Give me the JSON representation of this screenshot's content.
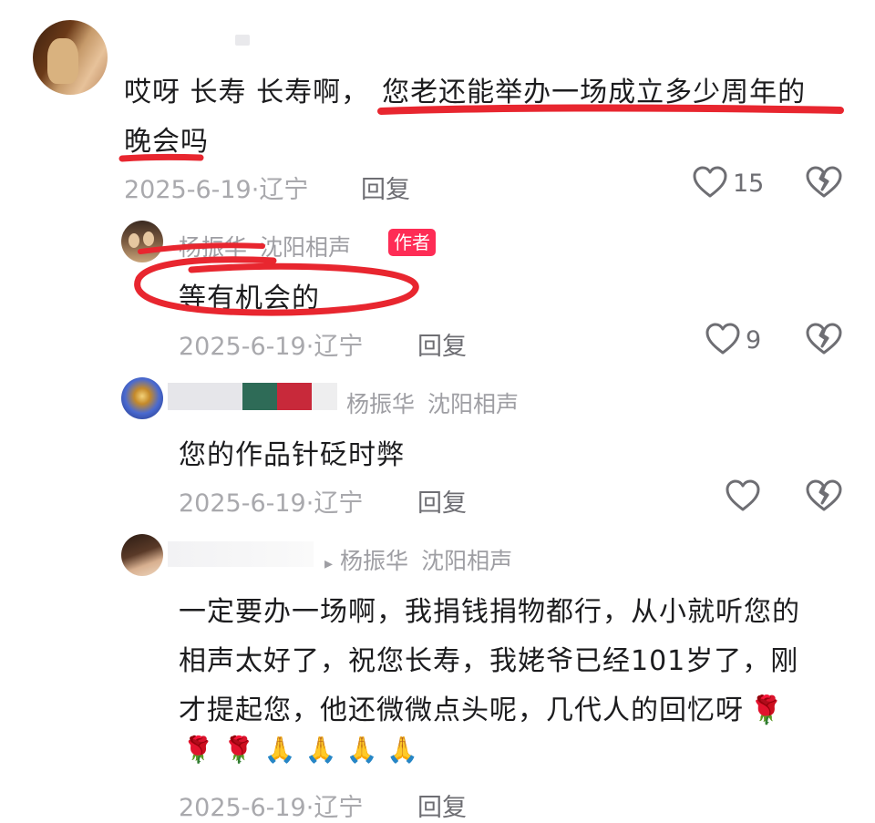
{
  "comments": [
    {
      "username": "",
      "text_line1_plain": "哎呀 长寿 长寿啊，",
      "text_line1_marked": "您老还能举办一场成立多少周年的",
      "text_line2": "晚会吗",
      "date": "2025-6-19",
      "sep": "·",
      "location": "辽宁",
      "reply_label": "回复",
      "like_count": "15"
    },
    {
      "username": "杨振华",
      "reply_to_suffix": "沈阳相声",
      "badge": "作者",
      "text": "等有机会的",
      "date": "2025-6-19",
      "sep": "·",
      "location": "辽宁",
      "reply_label": "回复",
      "like_count": "9"
    },
    {
      "reply_to": "杨振华",
      "reply_to_suffix": "沈阳相声",
      "text": "您的作品针砭时弊",
      "date": "2025-6-19",
      "sep": "·",
      "location": "辽宁",
      "reply_label": "回复",
      "like_count": ""
    },
    {
      "arrow": "▸",
      "reply_to": "杨振华",
      "reply_to_suffix": "沈阳相声",
      "text_line1": "一定要办一场啊，我捐钱捐物都行，从小就听您的",
      "text_line2": "相声太好了，祝您长寿，我姥爷已经101岁了，刚",
      "text_line3": "才提起您，他还微微点头呢，几代人的回忆呀",
      "emoji_rose": "🌹",
      "emoji_pray": "🙏",
      "date": "2025-6-19",
      "sep": "·",
      "location": "辽宁",
      "reply_label": "回复"
    }
  ],
  "icons": {
    "like": "heart-outline-icon",
    "dislike": "broken-heart-icon"
  },
  "colors": {
    "annotation_red": "#e8262f",
    "author_badge": "#fe2c55",
    "meta_gray": "#a9a9ad"
  }
}
